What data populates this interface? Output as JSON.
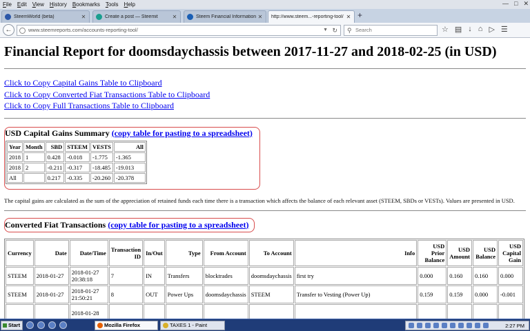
{
  "menubar": {
    "items": [
      "File",
      "Edit",
      "View",
      "History",
      "Bookmarks",
      "Tools",
      "Help"
    ]
  },
  "tabs": [
    {
      "label": "SteemWorld (beta)",
      "icon": "steemworld-favicon",
      "color": "#2b57a8"
    },
    {
      "label": "Create a post — Steemit",
      "icon": "steemit-favicon",
      "color": "#1a9e8f"
    },
    {
      "label": "Steem Financial Information",
      "icon": "steem-favicon",
      "color": "#1a5fb4"
    },
    {
      "label": "http://www.steem...-reporting-tool/",
      "icon": "page-favicon",
      "color": "#cccccc",
      "active": true
    }
  ],
  "new_tab_label": "+",
  "navbar": {
    "url": "www.steemreports.com/accounts-reporting-tool/",
    "search_placeholder": "Search"
  },
  "page": {
    "title": "Financial Report for doomsdaychassis between 2017-11-27 and 2018-02-25 (in USD)",
    "links": [
      "Click to Copy Capital Gains Table to Clipboard",
      "Click to Copy Converted Fiat Transactions Table to Clipboard",
      "Click to Copy Full Transactions Table to Clipboard"
    ],
    "capital_gains": {
      "heading": "USD Capital Gains Summary",
      "copy_link": "(copy table for pasting to a spreadsheet)",
      "columns": [
        "Year",
        "Month",
        "SBD",
        "STEEM",
        "VESTS",
        "All"
      ],
      "rows": [
        [
          "2018",
          "1",
          "0.428",
          "-0.018",
          "-1.775",
          "-1.365"
        ],
        [
          "2018",
          "2",
          "-0.211",
          "-0.317",
          "-18.485",
          "-19.013"
        ],
        [
          "All",
          "",
          "0.217",
          "-0.335",
          "-20.260",
          "-20.378"
        ]
      ]
    },
    "note": "The capital gains are calculated as the sum of the appreciation of retained funds each time there is a transaction which affects the balance of each relevant asset (STEEM, SBDs or VESTs). Values are presented in USD.",
    "fiat": {
      "heading": "Converted Fiat Transactions",
      "copy_link": "(copy table for pasting to a spreadsheet)",
      "columns": [
        "Currency",
        "Date",
        "Date/Time",
        "Transaction ID",
        "In/Out",
        "Type",
        "From Account",
        "To Account",
        "Info",
        "USD Prior Balance",
        "USD Amount",
        "USD Balance",
        "USD Capital Gain"
      ],
      "rows": [
        [
          "STEEM",
          "2018-01-27",
          "2018-01-27 20:38:18",
          "7",
          "IN",
          "Transfers",
          "blocktrades",
          "doomsdaychassis",
          "first try",
          "0.000",
          "0.160",
          "0.160",
          "0.000"
        ],
        [
          "STEEM",
          "2018-01-27",
          "2018-01-27 21:50:21",
          "8",
          "OUT",
          "Power Ups",
          "doomsdaychassis",
          "STEEM",
          "Transfer to Vesting (Power Up)",
          "0.159",
          "0.159",
          "0.000",
          "-0.001"
        ],
        [
          "",
          "",
          "2018-01-28",
          "",
          "",
          "",
          "",
          "",
          "",
          "",
          "",
          "",
          ""
        ]
      ]
    }
  },
  "taskbar": {
    "start_label": "Start",
    "tasks": [
      {
        "label": "Mozilla Firefox",
        "active": true
      },
      {
        "label": "TAXES 1 - Paint",
        "active": false
      }
    ],
    "clock": "2:27 PM"
  }
}
